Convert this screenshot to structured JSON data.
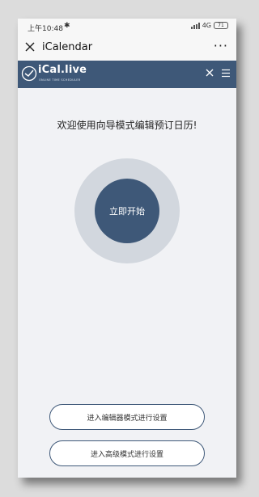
{
  "status_bar": {
    "time": "上午10:48",
    "bluetooth_icon": "bluetooth-icon",
    "network": "4G",
    "battery": "71"
  },
  "titlebar": {
    "title": "iCalendar",
    "more": "···"
  },
  "navbar": {
    "logo_text": "iCal.live",
    "logo_sub": "ONLINE TIME SCHEDULER"
  },
  "main": {
    "welcome": "欢迎使用向导模式编辑预订日历!",
    "start_button": "立即开始",
    "editor_button": "进入编辑器模式进行设置",
    "advanced_button": "进入高级模式进行设置"
  },
  "colors": {
    "navbar": "#3e5878",
    "ring": "#d2d7de",
    "background": "#f1f2f5"
  }
}
